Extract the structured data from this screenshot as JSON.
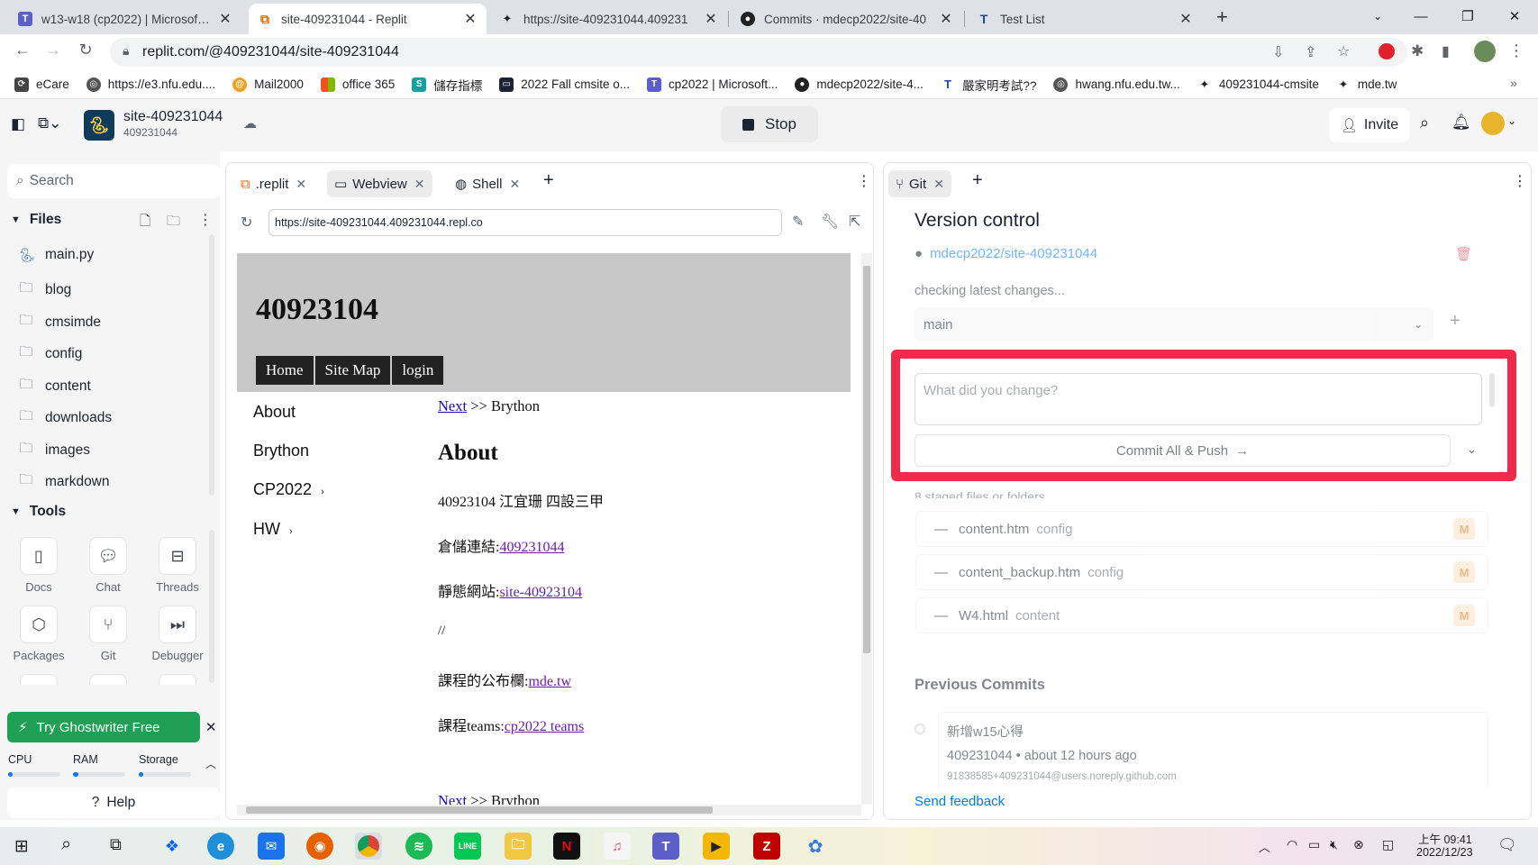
{
  "browser": {
    "tabs": [
      {
        "title": "w13-w18 (cp2022) | Microsoft T",
        "icon": "teams-icon",
        "active": false
      },
      {
        "title": "site-409231044 - Replit",
        "icon": "replit-icon",
        "active": true
      },
      {
        "title": "https://site-409231044.409231",
        "icon": "brython-icon",
        "active": false
      },
      {
        "title": "Commits · mdecp2022/site-40",
        "icon": "github-icon",
        "active": false
      },
      {
        "title": "Test List",
        "icon": "te-icon",
        "active": false
      }
    ],
    "url": "replit.com/@409231044/site-409231044",
    "bookmarks": [
      "eCare",
      "https://e3.nfu.edu....",
      "Mail2000",
      "office 365",
      "儲存指標",
      "2022 Fall cmsite o...",
      "cp2022 | Microsoft...",
      "mdecp2022/site-4...",
      "嚴家明考試??",
      "hwang.nfu.edu.tw...",
      "409231044-cmsite",
      "mde.tw"
    ]
  },
  "replit": {
    "repl_name": "site-409231044",
    "repl_owner": "409231044",
    "stop_label": "Stop",
    "invite_label": "Invite",
    "sidebar": {
      "search_placeholder": "Search",
      "files_label": "Files",
      "files": [
        "main.py",
        "blog",
        "cmsimde",
        "config",
        "content",
        "downloads",
        "images",
        "markdown"
      ],
      "tools_label": "Tools",
      "tools": [
        "Docs",
        "Chat",
        "Threads",
        "Packages",
        "Git",
        "Debugger"
      ],
      "ghostwriter_label": "Try Ghostwriter Free",
      "resources": [
        "CPU",
        "RAM",
        "Storage"
      ],
      "resource_levels": [
        0,
        0.1,
        0.05
      ],
      "help_label": "Help"
    },
    "webview_pane": {
      "tabs": [
        ".replit",
        "Webview",
        "Shell"
      ],
      "url": "https://site-409231044.409231044.repl.co"
    },
    "git_pane": {
      "tab_label": "Git",
      "title": "Version control",
      "repo": "mdecp2022/site-409231044",
      "status": "checking latest changes...",
      "branch": "main",
      "commit_placeholder": "What did you change?",
      "commit_button": "Commit All & Push",
      "staged_label": "8 staged files or folders",
      "files": [
        {
          "name": "content.htm",
          "dir": "config",
          "badge": "M"
        },
        {
          "name": "content_backup.htm",
          "dir": "config",
          "badge": "M"
        },
        {
          "name": "W4.html",
          "dir": "content",
          "badge": "M"
        }
      ],
      "previous_commits_label": "Previous Commits",
      "commit": {
        "message": "新增w15心得",
        "meta": "409231044 • about 12 hours ago",
        "email": "91838585+409231044@users.noreply.github.com"
      },
      "feedback_label": "Send feedback"
    }
  },
  "site": {
    "title": "40923104",
    "nav": [
      "Home",
      "Site Map",
      "login"
    ],
    "menu": [
      "About",
      "Brython",
      "CP2022",
      "HW"
    ],
    "next_label": "Next",
    "breadcrumb_rest": ">> Brython",
    "heading": "About",
    "line1": "40923104 江宜珊 四設三甲",
    "repo_prefix": "倉儲連結:",
    "repo_link": "409231044",
    "static_prefix": "靜態網站:",
    "static_link": "site-40923104",
    "slashes": "//",
    "board_prefix": "課程的公布欄:",
    "board_link": "mde.tw",
    "teams_prefix": "課程teams:",
    "teams_link": "cp2022 teams",
    "bottom_next": "Next",
    "bottom_rest": ">> Brython"
  },
  "taskbar": {
    "time": "上午 09:41",
    "date": "2022/12/23"
  }
}
